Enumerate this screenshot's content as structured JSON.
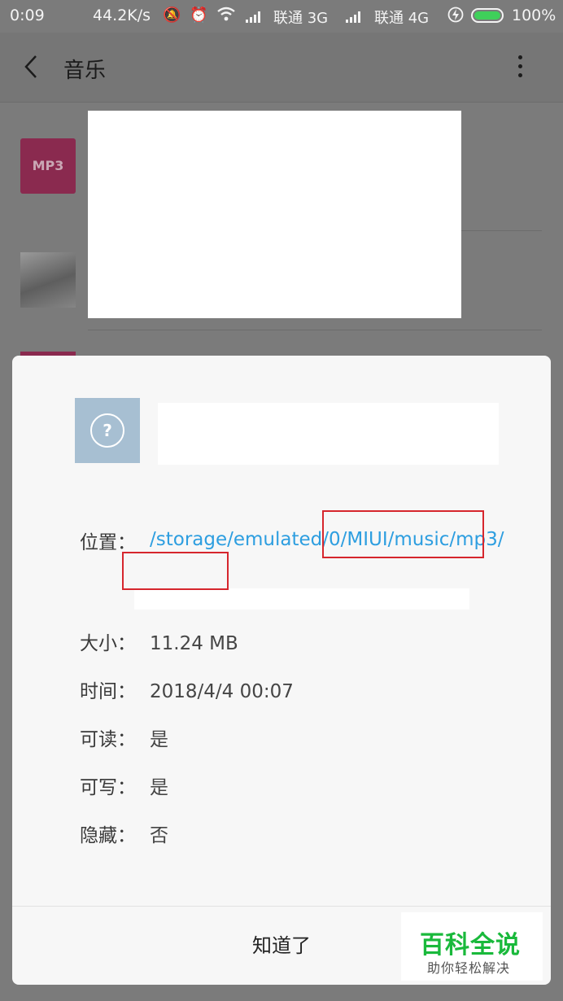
{
  "status_bar": {
    "time": "0:09",
    "speed": "44.2K/s",
    "carrier1": "联通 3G",
    "carrier2": "联通 4G",
    "battery": "100%",
    "battery_level": 1.0,
    "battery_color": "#3fd05a"
  },
  "app_bar": {
    "title": "音乐"
  },
  "list": {
    "items": [
      {
        "thumb_label": "MP3"
      }
    ]
  },
  "dialog": {
    "location_label": "位置：",
    "location_value": "/storage/emulated/0/MIUI/music/mp3/",
    "size_label": "大小：",
    "size_value": "11.24 MB",
    "time_label": "时间：",
    "time_value": "2018/4/4 00:07",
    "readable_label": "可读：",
    "readable_value": "是",
    "writable_label": "可写：",
    "writable_value": "是",
    "hidden_label": "隐藏：",
    "hidden_value": "否",
    "ok_button": "知道了"
  },
  "watermark": {
    "main": "百科全说",
    "sub": "助你轻松解决"
  },
  "colors": {
    "link": "#2d9ee0",
    "highlight_box": "#d6262d",
    "watermark_green": "#19b93b"
  }
}
